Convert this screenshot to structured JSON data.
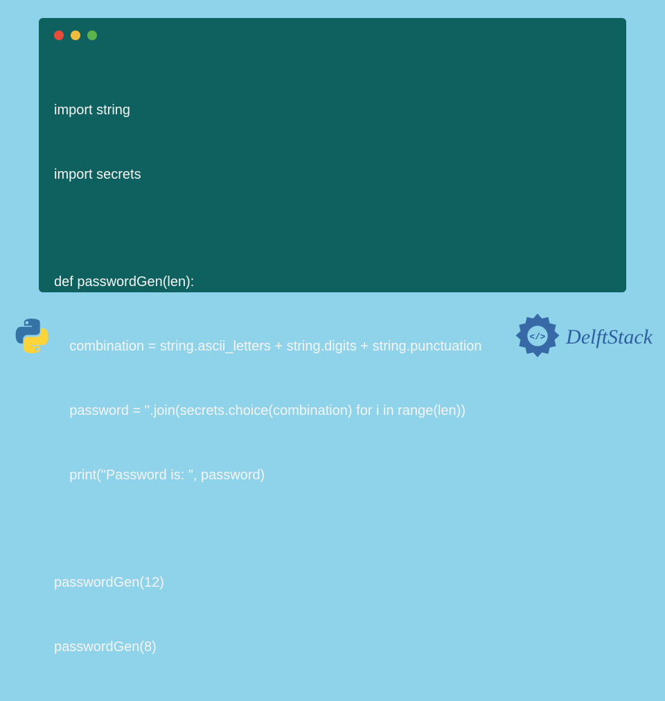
{
  "code": {
    "lines": [
      "import string",
      "import secrets",
      "",
      "def passwordGen(len):",
      "    combination = string.ascii_letters + string.digits + string.punctuation",
      "    password = ''.join(secrets.choice(combination) for i in range(len))",
      "    print(\"Password is: \", password)",
      "",
      "passwordGen(12)",
      "passwordGen(8)"
    ]
  },
  "brand": {
    "name": "DelftStack"
  },
  "colors": {
    "page_bg": "#8fd3ea",
    "window_bg": "#0e615e",
    "code_text": "#f4f4f4",
    "brand_text": "#2f5fa0",
    "python_blue": "#3572A5",
    "python_yellow": "#ffd43b"
  }
}
